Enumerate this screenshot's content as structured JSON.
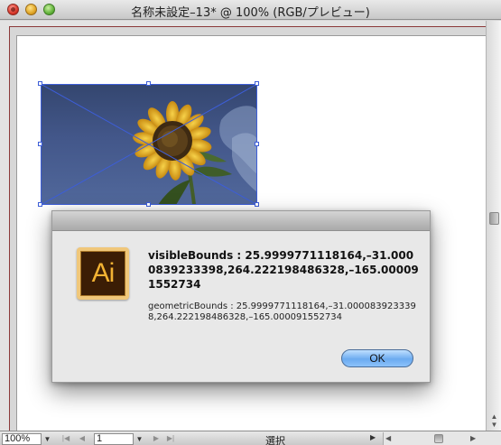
{
  "window": {
    "title": "名称未設定–13* @ 100% (RGB/プレビュー)"
  },
  "statusbar": {
    "zoom": "100%",
    "page": "1",
    "tool_status": "選択"
  },
  "dialog": {
    "icon_label": "Ai",
    "visible_bounds_text": "visibleBounds : 25.9999771118164,–31.0000839233398,264.222198486328,–165.000091552734",
    "geometric_bounds_text": "geometricBounds : 25.9999771118164,–31.0000839233398,264.222198486328,–165.000091552734",
    "ok_label": "OK"
  },
  "icons": [
    "close-icon",
    "minimize-icon",
    "zoom-icon",
    "illustrator-app-icon"
  ],
  "colors": {
    "selection_blue": "#3d5ed8",
    "artboard_border": "#8b3a3a",
    "ok_button": "#6cabf0",
    "ai_icon_bg": "#3b1d05",
    "ai_icon_text": "#f2b233"
  }
}
